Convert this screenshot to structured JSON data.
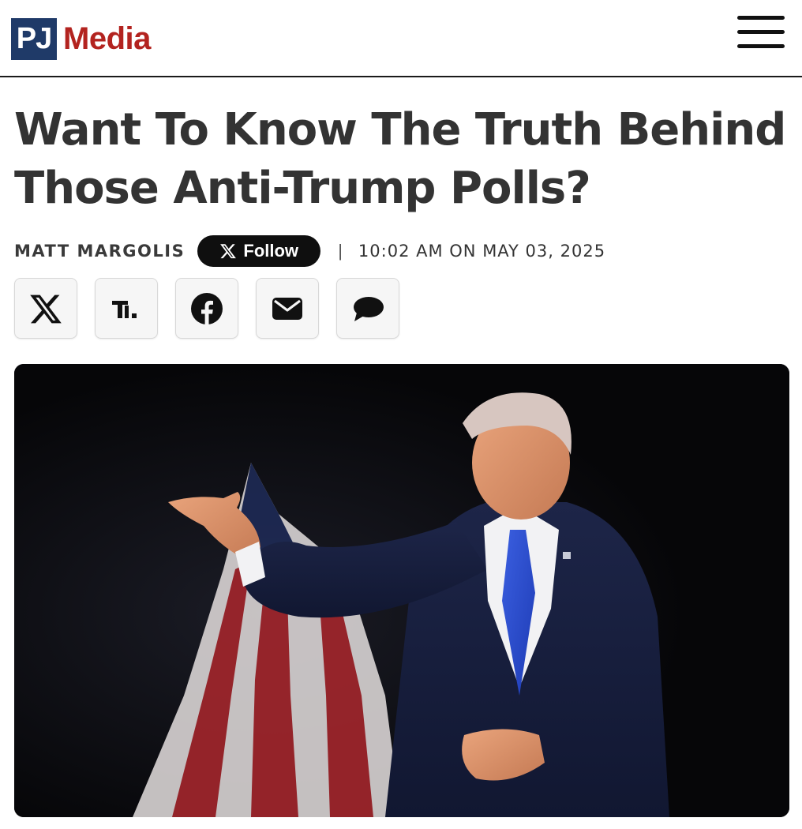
{
  "site": {
    "logo_mark": "PJ",
    "logo_word": "Media",
    "menu_icon": "hamburger-menu-icon"
  },
  "article": {
    "headline": "Want To Know The Truth Behind Those Anti-Trump Polls?",
    "author": "MATT MARGOLIS",
    "follow_label": "Follow",
    "separator": "|",
    "dateline": "10:02 AM ON MAY 03, 2025"
  },
  "share_buttons": [
    {
      "icon": "x-icon"
    },
    {
      "icon": "truth-social-icon"
    },
    {
      "icon": "facebook-icon"
    },
    {
      "icon": "email-icon"
    },
    {
      "icon": "comment-icon"
    }
  ],
  "colors": {
    "brand_blue": "#1f3a68",
    "brand_red": "#b3231f",
    "headline": "#333333",
    "follow_bg": "#0f0f0f"
  }
}
